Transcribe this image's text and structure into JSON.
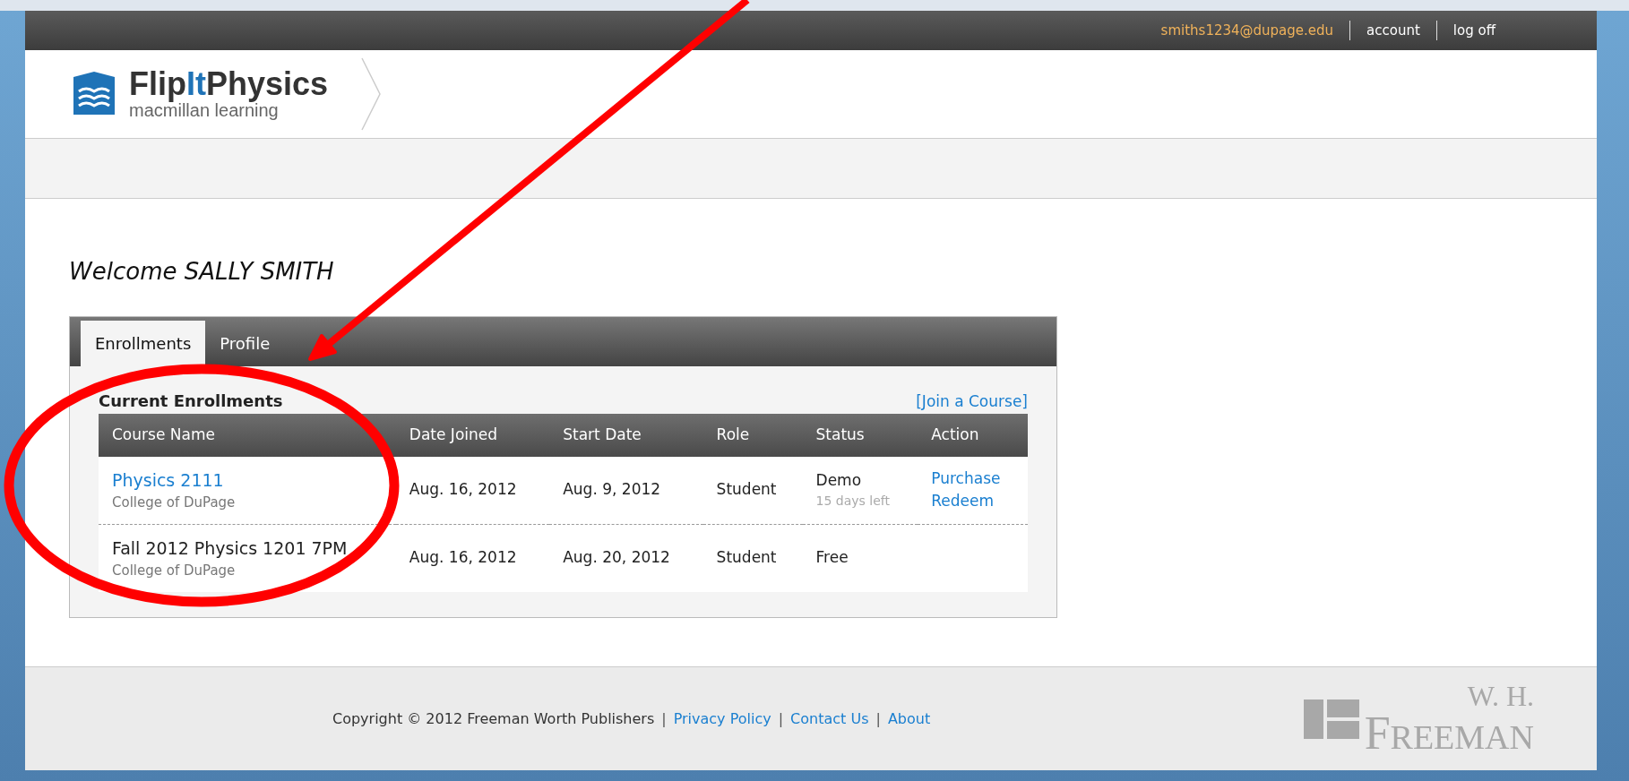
{
  "header": {
    "user_email": "smiths1234@dupage.edu",
    "links": [
      "account",
      "log off"
    ],
    "logo": {
      "name_parts": [
        {
          "text": "Flip",
          "accent": false
        },
        {
          "text": "It",
          "accent": true
        },
        {
          "text": "Physics",
          "accent": false
        }
      ],
      "tagline": "macmillan learning"
    }
  },
  "welcome": "Welcome SALLY SMITH",
  "tabs": [
    {
      "label": "Enrollments",
      "selected": true
    },
    {
      "label": "Profile",
      "selected": false
    }
  ],
  "section_title": "Current Enrollments",
  "join_link": "[Join a Course]",
  "table": {
    "columns": [
      "Course Name",
      "Date Joined",
      "Start Date",
      "Role",
      "Status",
      "Action"
    ],
    "rows": [
      {
        "course": "Physics 2111",
        "course_link": true,
        "school": "College of DuPage",
        "date_joined": "Aug. 16, 2012",
        "start_date": "Aug. 9, 2012",
        "role": "Student",
        "status": "Demo",
        "status_note": "15 days left",
        "actions": [
          "Purchase",
          "Redeem"
        ]
      },
      {
        "course": "Fall 2012 Physics 1201 7PM",
        "course_link": false,
        "school": "College of DuPage",
        "date_joined": "Aug. 16, 2012",
        "start_date": "Aug. 20, 2012",
        "role": "Student",
        "status": "Free"
      }
    ]
  },
  "footer": {
    "copyright": "Copyright © 2012 Freeman Worth Publishers",
    "separator": "|",
    "links": [
      "Privacy Policy",
      "Contact Us",
      "About"
    ],
    "logo": {
      "line1": "W. H.",
      "line2": "FREEMAN"
    }
  }
}
